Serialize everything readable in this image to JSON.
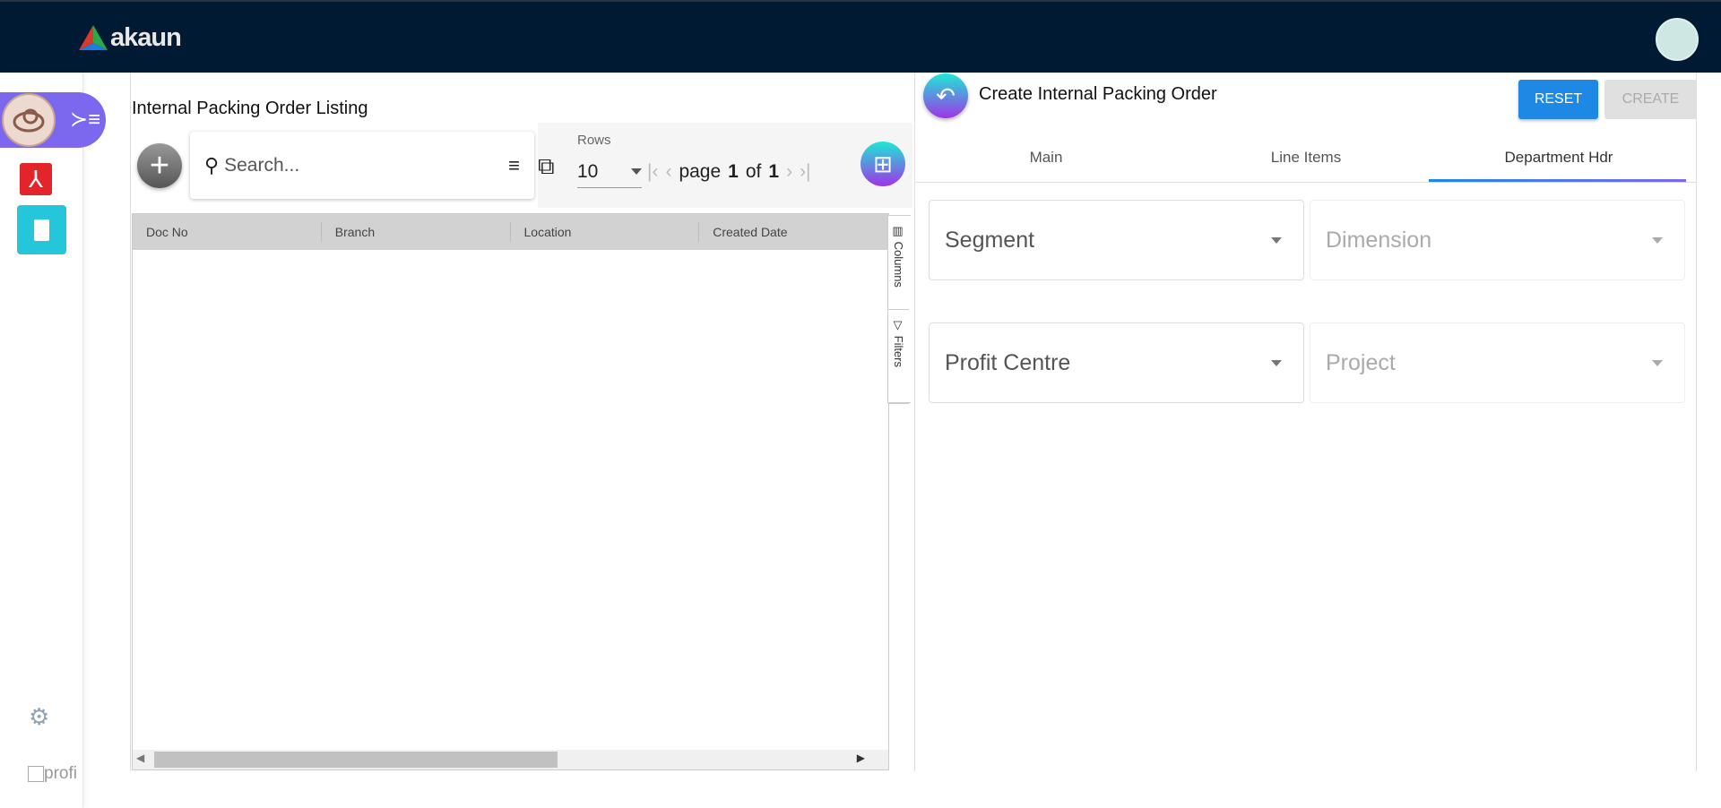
{
  "app": {
    "brand": "akaun"
  },
  "sidebar": {
    "footer_label": "profi"
  },
  "listing": {
    "title": "Internal Packing Order Listing",
    "search_placeholder": "Search...",
    "rows_label": "Rows",
    "rows_value": "10",
    "page_word": "page",
    "page_current": "1",
    "of_word": "of",
    "page_total": "1",
    "columns": [
      "Doc No",
      "Branch",
      "Location",
      "Created Date"
    ],
    "side_tabs": [
      "Columns",
      "Filters"
    ]
  },
  "form": {
    "title": "Create Internal Packing Order",
    "reset_label": "RESET",
    "create_label": "CREATE",
    "tabs": [
      "Main",
      "Line Items",
      "Department Hdr"
    ],
    "active_tab": "Department Hdr",
    "fields": [
      {
        "label": "Segment",
        "enabled": true
      },
      {
        "label": "Dimension",
        "enabled": false
      },
      {
        "label": "Profit Centre",
        "enabled": true
      },
      {
        "label": "Project",
        "enabled": false
      }
    ]
  },
  "colors": {
    "topbar": "#001a33",
    "accent": "#1e88e5",
    "sidebar_pill": "#7b68ee",
    "clipboard": "#26c6da"
  }
}
